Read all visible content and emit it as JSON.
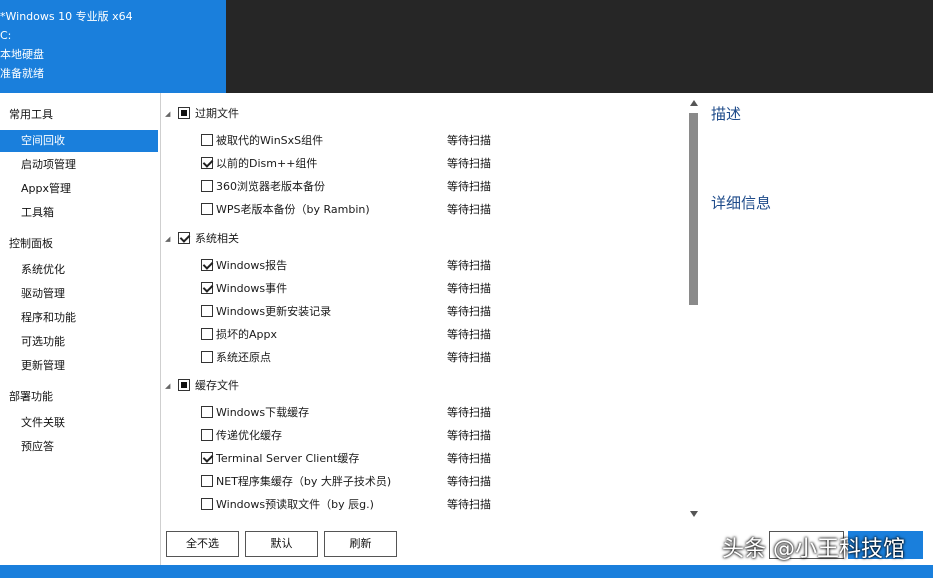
{
  "drive": {
    "os": "*Windows 10 专业版 x64",
    "letter": "C:",
    "type": "本地硬盘",
    "status": "准备就绪"
  },
  "sidebar": {
    "groups": [
      {
        "label": "常用工具",
        "items": [
          "空间回收",
          "启动项管理",
          "Appx管理",
          "工具箱"
        ]
      },
      {
        "label": "控制面板",
        "items": [
          "系统优化",
          "驱动管理",
          "程序和功能",
          "可选功能",
          "更新管理"
        ]
      },
      {
        "label": "部署功能",
        "items": [
          "文件关联",
          "预应答"
        ]
      }
    ],
    "selected": "空间回收"
  },
  "cleanup": {
    "groups": [
      {
        "label": "过期文件",
        "state": "partial",
        "items": [
          {
            "label": "被取代的WinSxS组件",
            "checked": false,
            "status": "等待扫描"
          },
          {
            "label": "以前的Dism++组件",
            "checked": true,
            "status": "等待扫描"
          },
          {
            "label": "360浏览器老版本备份",
            "checked": false,
            "status": "等待扫描"
          },
          {
            "label": "WPS老版本备份（by Rambin)",
            "checked": false,
            "status": "等待扫描"
          }
        ]
      },
      {
        "label": "系统相关",
        "state": "checked",
        "items": [
          {
            "label": "Windows报告",
            "checked": true,
            "status": "等待扫描"
          },
          {
            "label": "Windows事件",
            "checked": true,
            "status": "等待扫描"
          },
          {
            "label": "Windows更新安装记录",
            "checked": false,
            "status": "等待扫描"
          },
          {
            "label": "损坏的Appx",
            "checked": false,
            "status": "等待扫描"
          },
          {
            "label": "系统还原点",
            "checked": false,
            "status": "等待扫描"
          }
        ]
      },
      {
        "label": "缓存文件",
        "state": "partial",
        "items": [
          {
            "label": "Windows下载缓存",
            "checked": false,
            "status": "等待扫描"
          },
          {
            "label": "传递优化缓存",
            "checked": false,
            "status": "等待扫描"
          },
          {
            "label": "Terminal Server Client缓存",
            "checked": true,
            "status": "等待扫描"
          },
          {
            "label": "NET程序集缓存（by 大胖子技术员)",
            "checked": false,
            "status": "等待扫描"
          },
          {
            "label": "Windows预读取文件（by 辰g.)",
            "checked": false,
            "status": "等待扫描"
          }
        ]
      }
    ]
  },
  "buttons": {
    "deselect_all": "全不选",
    "default": "默认",
    "refresh": "刷新"
  },
  "right_panel": {
    "description": "描述",
    "details": "详细信息"
  },
  "watermark": "头条 @小王科技馆",
  "colors": {
    "accent": "#1a7fdc",
    "header_dark": "#262626",
    "panel_title": "#1e4b8a"
  }
}
